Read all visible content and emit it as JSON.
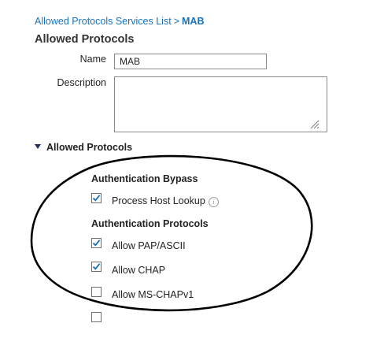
{
  "breadcrumb": {
    "parent": "Allowed Protocols Services List",
    "separator": ">",
    "current": "MAB"
  },
  "page": {
    "title": "Allowed Protocols"
  },
  "form": {
    "name_label": "Name",
    "name_value": "MAB",
    "description_label": "Description",
    "description_value": ""
  },
  "section": {
    "title": "Allowed Protocols",
    "expanded": true
  },
  "authentication_bypass": {
    "heading": "Authentication Bypass",
    "process_host_lookup": {
      "label": "Process Host Lookup",
      "checked": true,
      "info_icon": "i"
    }
  },
  "authentication_protocols": {
    "heading": "Authentication Protocols",
    "items": [
      {
        "label": "Allow PAP/ASCII",
        "checked": true
      },
      {
        "label": "Allow CHAP",
        "checked": true
      },
      {
        "label": "Allow MS-CHAPv1",
        "checked": false
      },
      {
        "label": "",
        "checked": false
      }
    ]
  },
  "colors": {
    "link": "#1a73b8",
    "checkmark": "#1a6fb0",
    "annotation_ellipse": "#000000"
  }
}
